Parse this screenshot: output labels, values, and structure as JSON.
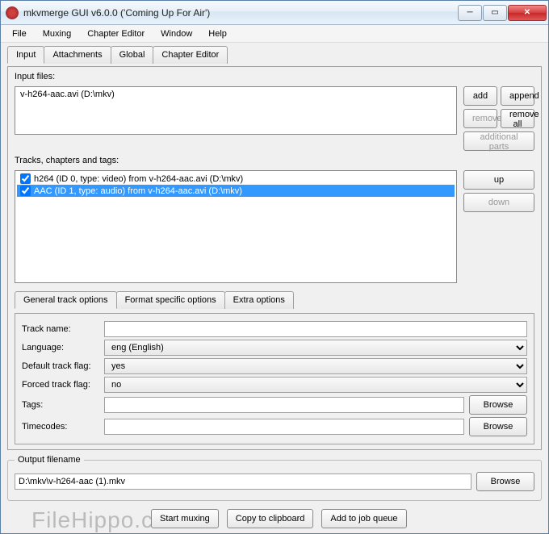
{
  "window": {
    "title": "mkvmerge GUI v6.0.0 ('Coming Up For Air')"
  },
  "menu": {
    "file": "File",
    "muxing": "Muxing",
    "chapter": "Chapter Editor",
    "window": "Window",
    "help": "Help"
  },
  "main_tabs": {
    "input": "Input",
    "attachments": "Attachments",
    "global": "Global",
    "chapter": "Chapter Editor"
  },
  "input": {
    "files_label": "Input files:",
    "files": [
      "v-h264-aac.avi (D:\\mkv)"
    ],
    "btn_add": "add",
    "btn_append": "append",
    "btn_remove": "remove",
    "btn_removeall": "remove all",
    "btn_parts": "additional parts",
    "tracks_label": "Tracks, chapters and tags:",
    "tracks": [
      {
        "text": "h264 (ID 0, type: video) from v-h264-aac.avi (D:\\mkv)",
        "checked": true,
        "selected": false
      },
      {
        "text": "AAC (ID 1, type: audio) from v-h264-aac.avi (D:\\mkv)",
        "checked": true,
        "selected": true
      }
    ],
    "btn_up": "up",
    "btn_down": "down"
  },
  "opt_tabs": {
    "general": "General track options",
    "format": "Format specific options",
    "extra": "Extra options"
  },
  "opts": {
    "trackname_lbl": "Track name:",
    "trackname": "",
    "language_lbl": "Language:",
    "language": "eng (English)",
    "default_lbl": "Default track flag:",
    "default": "yes",
    "forced_lbl": "Forced track flag:",
    "forced": "no",
    "tags_lbl": "Tags:",
    "tags": "",
    "timecodes_lbl": "Timecodes:",
    "timecodes": "",
    "browse": "Browse"
  },
  "output": {
    "label": "Output filename",
    "value": "D:\\mkv\\v-h264-aac (1).mkv",
    "browse": "Browse"
  },
  "bottom": {
    "start": "Start muxing",
    "copy": "Copy to clipboard",
    "queue": "Add to job queue"
  },
  "watermark": "FileHippo.com"
}
